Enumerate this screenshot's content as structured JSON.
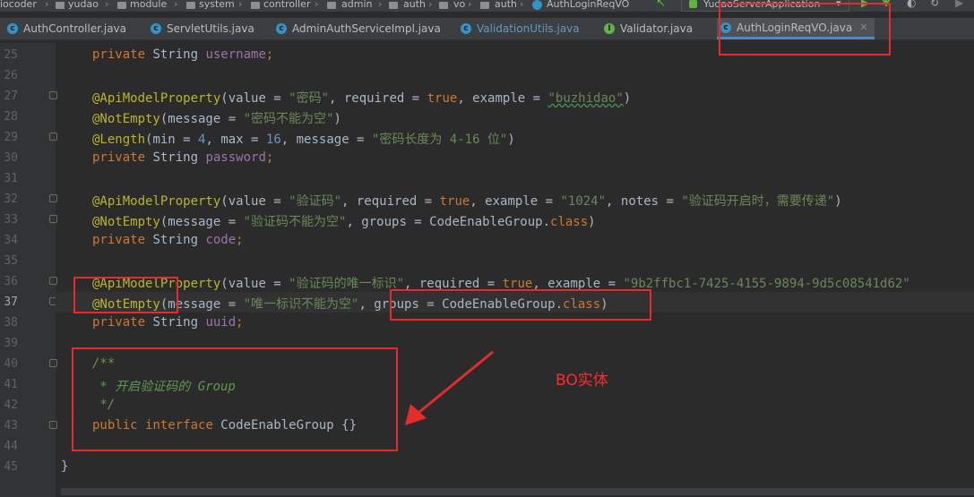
{
  "breadcrumb": [
    "iocoder",
    "yudao",
    "module",
    "system",
    "controller",
    "admin",
    "auth",
    "vo",
    "auth",
    "AuthLoginReqVO"
  ],
  "run_config": "YudaoServerApplication",
  "tabs": [
    {
      "label": "AuthController.java",
      "kind": "class"
    },
    {
      "label": "ServletUtils.java",
      "kind": "class"
    },
    {
      "label": "AdminAuthServiceImpl.java",
      "kind": "class"
    },
    {
      "label": "ValidationUtils.java",
      "kind": "class"
    },
    {
      "label": "Validator.java",
      "kind": "interface"
    },
    {
      "label": "AuthLoginReqVO.java",
      "kind": "class",
      "active": true
    }
  ],
  "line_numbers": [
    "25",
    "26",
    "27",
    "28",
    "29",
    "30",
    "31",
    "32",
    "33",
    "34",
    "35",
    "36",
    "37",
    "38",
    "39",
    "40",
    "41",
    "42",
    "43",
    "44",
    "45"
  ],
  "current_line": "37",
  "code": {
    "l25": [
      "private",
      " String ",
      "username",
      ";"
    ],
    "l27": [
      "@ApiModelProperty",
      "(value = ",
      "\"密码\"",
      ", required = ",
      "true",
      ", example = ",
      "\"buzhidao\"",
      ")"
    ],
    "l28": [
      "@NotEmpty",
      "(message = ",
      "\"密码不能为空\"",
      ")"
    ],
    "l29": [
      "@Length",
      "(min = ",
      "4",
      ", max = ",
      "16",
      ", message = ",
      "\"密码长度为 4-16 位\"",
      ")"
    ],
    "l30": [
      "private",
      " String ",
      "password",
      ";"
    ],
    "l32": [
      "@ApiModelProperty",
      "(value = ",
      "\"验证码\"",
      ", required = ",
      "true",
      ", example = ",
      "\"1024\"",
      ", notes = ",
      "\"验证码开启时，需要传递\"",
      ")"
    ],
    "l33": [
      "@NotEmpty",
      "(message = ",
      "\"验证码不能为空\"",
      ", groups = CodeEnableGroup.",
      "class",
      ")"
    ],
    "l34": [
      "private",
      " String ",
      "code",
      ";"
    ],
    "l36": [
      "@ApiModelProperty",
      "(value = ",
      "\"验证码的唯一标识\"",
      ", required = ",
      "true",
      ", example = ",
      "\"9b2ffbc1-7425-4155-9894-9d5c08541d62\""
    ],
    "l37": [
      "@NotEmpty",
      "(message = ",
      "\"唯一标识不能为空\"",
      ", groups = CodeEnableGroup.",
      "class",
      ")"
    ],
    "l38": [
      "private",
      " String ",
      "uuid",
      ";"
    ],
    "l40": "/**",
    "l41": " * 开启验证码的 Group",
    "l42": " */",
    "l43": [
      "public ",
      "interface",
      " CodeEnableGroup {}"
    ],
    "l45": "}"
  },
  "annotation_label": "BO实体",
  "accent_colors": {
    "highlight": "#e52b2b",
    "keyword": "#cc7832",
    "string": "#6a8759",
    "annotation": "#bbb529",
    "field": "#9876aa",
    "number": "#6897bb"
  }
}
